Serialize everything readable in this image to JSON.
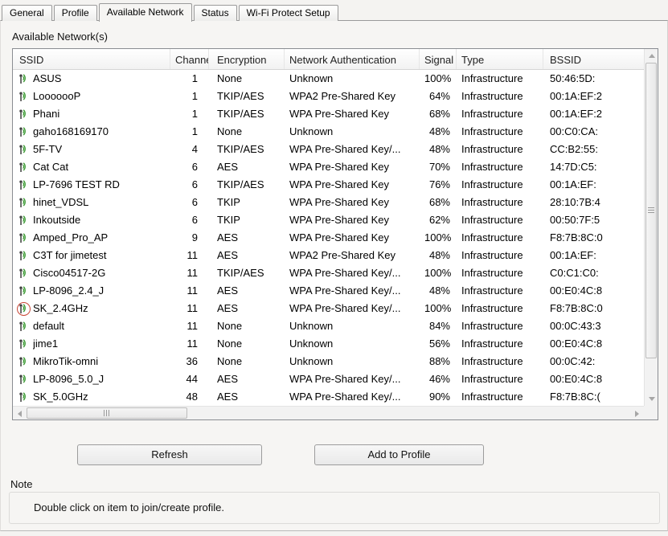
{
  "tabs": [
    {
      "label": "General",
      "active": false
    },
    {
      "label": "Profile",
      "active": false
    },
    {
      "label": "Available Network",
      "active": true
    },
    {
      "label": "Status",
      "active": false
    },
    {
      "label": "Wi-Fi Protect Setup",
      "active": false
    }
  ],
  "section_label": "Available Network(s)",
  "table": {
    "columns": [
      {
        "label": "SSID"
      },
      {
        "label": "Channel"
      },
      {
        "label": "Encryption"
      },
      {
        "label": "Network Authentication"
      },
      {
        "label": "Signal"
      },
      {
        "label": "Type"
      },
      {
        "label": "BSSID"
      }
    ],
    "rows": [
      {
        "ssid": "ASUS",
        "channel": "1",
        "encryption": "None",
        "auth": "Unknown",
        "signal": "100%",
        "type": "Infrastructure",
        "bssid": "50:46:5D:"
      },
      {
        "ssid": "LooooooP",
        "channel": "1",
        "encryption": "TKIP/AES",
        "auth": "WPA2 Pre-Shared Key",
        "signal": "64%",
        "type": "Infrastructure",
        "bssid": "00:1A:EF:2"
      },
      {
        "ssid": "Phani",
        "channel": "1",
        "encryption": "TKIP/AES",
        "auth": "WPA Pre-Shared Key",
        "signal": "68%",
        "type": "Infrastructure",
        "bssid": "00:1A:EF:2"
      },
      {
        "ssid": "gaho168169170",
        "channel": "1",
        "encryption": "None",
        "auth": "Unknown",
        "signal": "48%",
        "type": "Infrastructure",
        "bssid": "00:C0:CA:"
      },
      {
        "ssid": "5F-TV",
        "channel": "4",
        "encryption": "TKIP/AES",
        "auth": "WPA Pre-Shared Key/...",
        "signal": "48%",
        "type": "Infrastructure",
        "bssid": "CC:B2:55:"
      },
      {
        "ssid": "Cat Cat",
        "channel": "6",
        "encryption": "AES",
        "auth": "WPA Pre-Shared Key",
        "signal": "70%",
        "type": "Infrastructure",
        "bssid": "14:7D:C5:"
      },
      {
        "ssid": "LP-7696 TEST RD",
        "channel": "6",
        "encryption": "TKIP/AES",
        "auth": "WPA Pre-Shared Key",
        "signal": "76%",
        "type": "Infrastructure",
        "bssid": "00:1A:EF:"
      },
      {
        "ssid": "hinet_VDSL",
        "channel": "6",
        "encryption": "TKIP",
        "auth": "WPA Pre-Shared Key",
        "signal": "68%",
        "type": "Infrastructure",
        "bssid": "28:10:7B:4"
      },
      {
        "ssid": "Inkoutside",
        "channel": "6",
        "encryption": "TKIP",
        "auth": "WPA Pre-Shared Key",
        "signal": "62%",
        "type": "Infrastructure",
        "bssid": "00:50:7F:5"
      },
      {
        "ssid": "Amped_Pro_AP",
        "channel": "9",
        "encryption": "AES",
        "auth": "WPA Pre-Shared Key",
        "signal": "100%",
        "type": "Infrastructure",
        "bssid": "F8:7B:8C:0"
      },
      {
        "ssid": "C3T for jimetest",
        "channel": "11",
        "encryption": "AES",
        "auth": "WPA2 Pre-Shared Key",
        "signal": "48%",
        "type": "Infrastructure",
        "bssid": "00:1A:EF:"
      },
      {
        "ssid": "Cisco04517-2G",
        "channel": "11",
        "encryption": "TKIP/AES",
        "auth": "WPA Pre-Shared Key/...",
        "signal": "100%",
        "type": "Infrastructure",
        "bssid": "C0:C1:C0:"
      },
      {
        "ssid": "LP-8096_2.4_J",
        "channel": "11",
        "encryption": "AES",
        "auth": "WPA Pre-Shared Key/...",
        "signal": "48%",
        "type": "Infrastructure",
        "bssid": "00:E0:4C:8"
      },
      {
        "ssid": "SK_2.4GHz",
        "channel": "11",
        "encryption": "AES",
        "auth": "WPA Pre-Shared Key/...",
        "signal": "100%",
        "type": "Infrastructure",
        "bssid": "F8:7B:8C:0",
        "highlighted": true
      },
      {
        "ssid": "default",
        "channel": "11",
        "encryption": "None",
        "auth": "Unknown",
        "signal": "84%",
        "type": "Infrastructure",
        "bssid": "00:0C:43:3"
      },
      {
        "ssid": "jime1",
        "channel": "11",
        "encryption": "None",
        "auth": "Unknown",
        "signal": "56%",
        "type": "Infrastructure",
        "bssid": "00:E0:4C:8"
      },
      {
        "ssid": "MikroTik-omni",
        "channel": "36",
        "encryption": "None",
        "auth": "Unknown",
        "signal": "88%",
        "type": "Infrastructure",
        "bssid": "00:0C:42:"
      },
      {
        "ssid": "LP-8096_5.0_J",
        "channel": "44",
        "encryption": "AES",
        "auth": "WPA Pre-Shared Key/...",
        "signal": "46%",
        "type": "Infrastructure",
        "bssid": "00:E0:4C:8"
      },
      {
        "ssid": "SK_5.0GHz",
        "channel": "48",
        "encryption": "AES",
        "auth": "WPA Pre-Shared Key/...",
        "signal": "90%",
        "type": "Infrastructure",
        "bssid": "F8:7B:8C:("
      }
    ]
  },
  "buttons": {
    "refresh": "Refresh",
    "add_to_profile": "Add to Profile"
  },
  "note": {
    "label": "Note",
    "text": "Double click on item to join/create profile."
  },
  "colors": {
    "signal_wave_green": "#3d9b35",
    "highlight_ring_red": "#c94434"
  }
}
